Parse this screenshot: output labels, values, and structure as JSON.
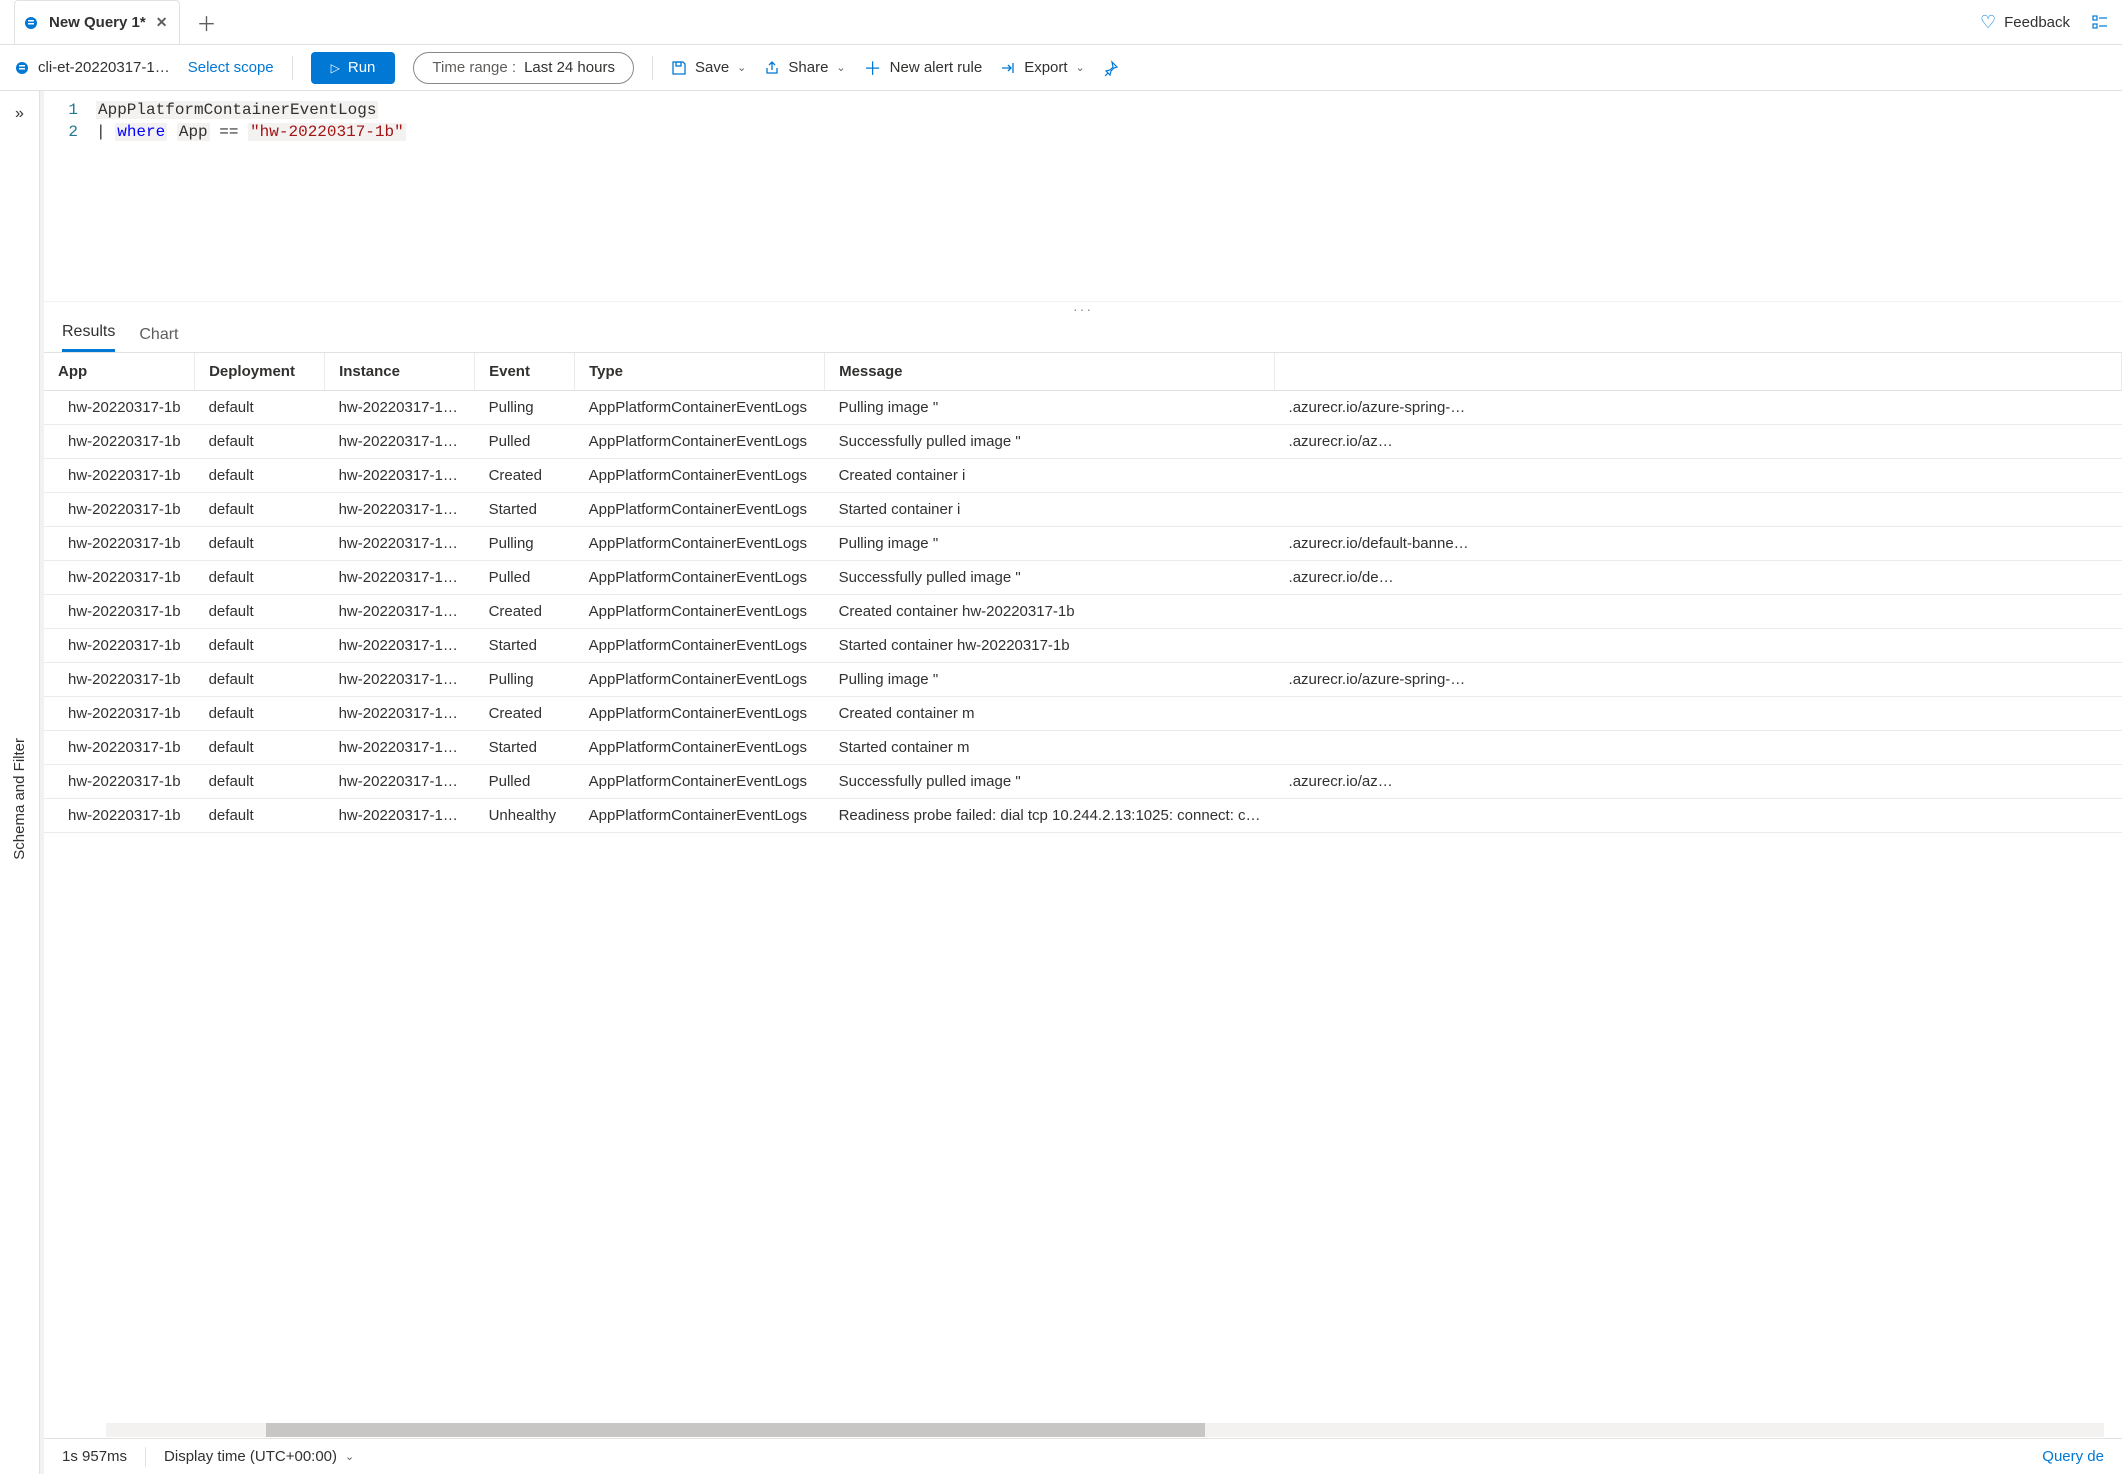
{
  "tabs": {
    "active": {
      "title": "New Query 1*"
    }
  },
  "header": {
    "feedback_label": "Feedback"
  },
  "toolbar": {
    "workspace": "cli-et-20220317-1…",
    "select_scope": "Select scope",
    "run_label": "Run",
    "time_label": "Time range :",
    "time_value": "Last 24 hours",
    "save_label": "Save",
    "share_label": "Share",
    "new_alert": "New alert rule",
    "export": "Export"
  },
  "sidebar": {
    "schema_label": "Schema and Filter"
  },
  "editor": {
    "lines": [
      {
        "n": "1"
      },
      {
        "n": "2"
      }
    ],
    "content": {
      "table": "AppPlatformContainerEventLogs",
      "pipe": "|",
      "where": "where",
      "col": "App",
      "op": "==",
      "str": "\"hw-20220317-1b\""
    }
  },
  "result_tabs": {
    "results": "Results",
    "chart": "Chart"
  },
  "table": {
    "headers": {
      "app": "App",
      "deployment": "Deployment",
      "instance": "Instance",
      "event": "Event",
      "type": "Type",
      "message": "Message"
    },
    "rows": [
      {
        "app": "hw-20220317-1b",
        "dep": "default",
        "inst": "hw-20220317-1…",
        "event": "Pulling",
        "type": "AppPlatformContainerEventLogs",
        "msg1": "Pulling image \"",
        "msg2": ".azurecr.io/azure-spring-…"
      },
      {
        "app": "hw-20220317-1b",
        "dep": "default",
        "inst": "hw-20220317-1…",
        "event": "Pulled",
        "type": "AppPlatformContainerEventLogs",
        "msg1": "Successfully pulled image \"",
        "msg2": ".azurecr.io/az…"
      },
      {
        "app": "hw-20220317-1b",
        "dep": "default",
        "inst": "hw-20220317-1…",
        "event": "Created",
        "type": "AppPlatformContainerEventLogs",
        "msg1": "Created container i",
        "msg2": ""
      },
      {
        "app": "hw-20220317-1b",
        "dep": "default",
        "inst": "hw-20220317-1…",
        "event": "Started",
        "type": "AppPlatformContainerEventLogs",
        "msg1": "Started container i",
        "msg2": ""
      },
      {
        "app": "hw-20220317-1b",
        "dep": "default",
        "inst": "hw-20220317-1…",
        "event": "Pulling",
        "type": "AppPlatformContainerEventLogs",
        "msg1": "Pulling image \"",
        "msg2": ".azurecr.io/default-banne…"
      },
      {
        "app": "hw-20220317-1b",
        "dep": "default",
        "inst": "hw-20220317-1…",
        "event": "Pulled",
        "type": "AppPlatformContainerEventLogs",
        "msg1": "Successfully pulled image \"",
        "msg2": ".azurecr.io/de…"
      },
      {
        "app": "hw-20220317-1b",
        "dep": "default",
        "inst": "hw-20220317-1…",
        "event": "Created",
        "type": "AppPlatformContainerEventLogs",
        "msg1": "Created container hw-20220317-1b",
        "msg2": ""
      },
      {
        "app": "hw-20220317-1b",
        "dep": "default",
        "inst": "hw-20220317-1…",
        "event": "Started",
        "type": "AppPlatformContainerEventLogs",
        "msg1": "Started container hw-20220317-1b",
        "msg2": ""
      },
      {
        "app": "hw-20220317-1b",
        "dep": "default",
        "inst": "hw-20220317-1…",
        "event": "Pulling",
        "type": "AppPlatformContainerEventLogs",
        "msg1": "Pulling image \"",
        "msg2": ".azurecr.io/azure-spring-…"
      },
      {
        "app": "hw-20220317-1b",
        "dep": "default",
        "inst": "hw-20220317-1…",
        "event": "Created",
        "type": "AppPlatformContainerEventLogs",
        "msg1": "Created container m",
        "msg2": ""
      },
      {
        "app": "hw-20220317-1b",
        "dep": "default",
        "inst": "hw-20220317-1…",
        "event": "Started",
        "type": "AppPlatformContainerEventLogs",
        "msg1": "Started container m",
        "msg2": ""
      },
      {
        "app": "hw-20220317-1b",
        "dep": "default",
        "inst": "hw-20220317-1…",
        "event": "Pulled",
        "type": "AppPlatformContainerEventLogs",
        "msg1": "Successfully pulled image \"",
        "msg2": ".azurecr.io/az…"
      },
      {
        "app": "hw-20220317-1b",
        "dep": "default",
        "inst": "hw-20220317-1…",
        "event": "Unhealthy",
        "type": "AppPlatformContainerEventLogs",
        "msg1": "Readiness probe failed: dial tcp 10.244.2.13:1025: connect: c…",
        "msg2": ""
      }
    ]
  },
  "status": {
    "duration": "1s 957ms",
    "display_time": "Display time (UTC+00:00)",
    "query_details": "Query de"
  },
  "glyphs": {
    "close": "✕",
    "plus": "＋",
    "heart": "♡",
    "save": "🖫",
    "share": "↗",
    "add": "＋",
    "export": "⇥",
    "pin": "📌",
    "chev": "⌄",
    "expand": "»",
    "grip": "···"
  }
}
